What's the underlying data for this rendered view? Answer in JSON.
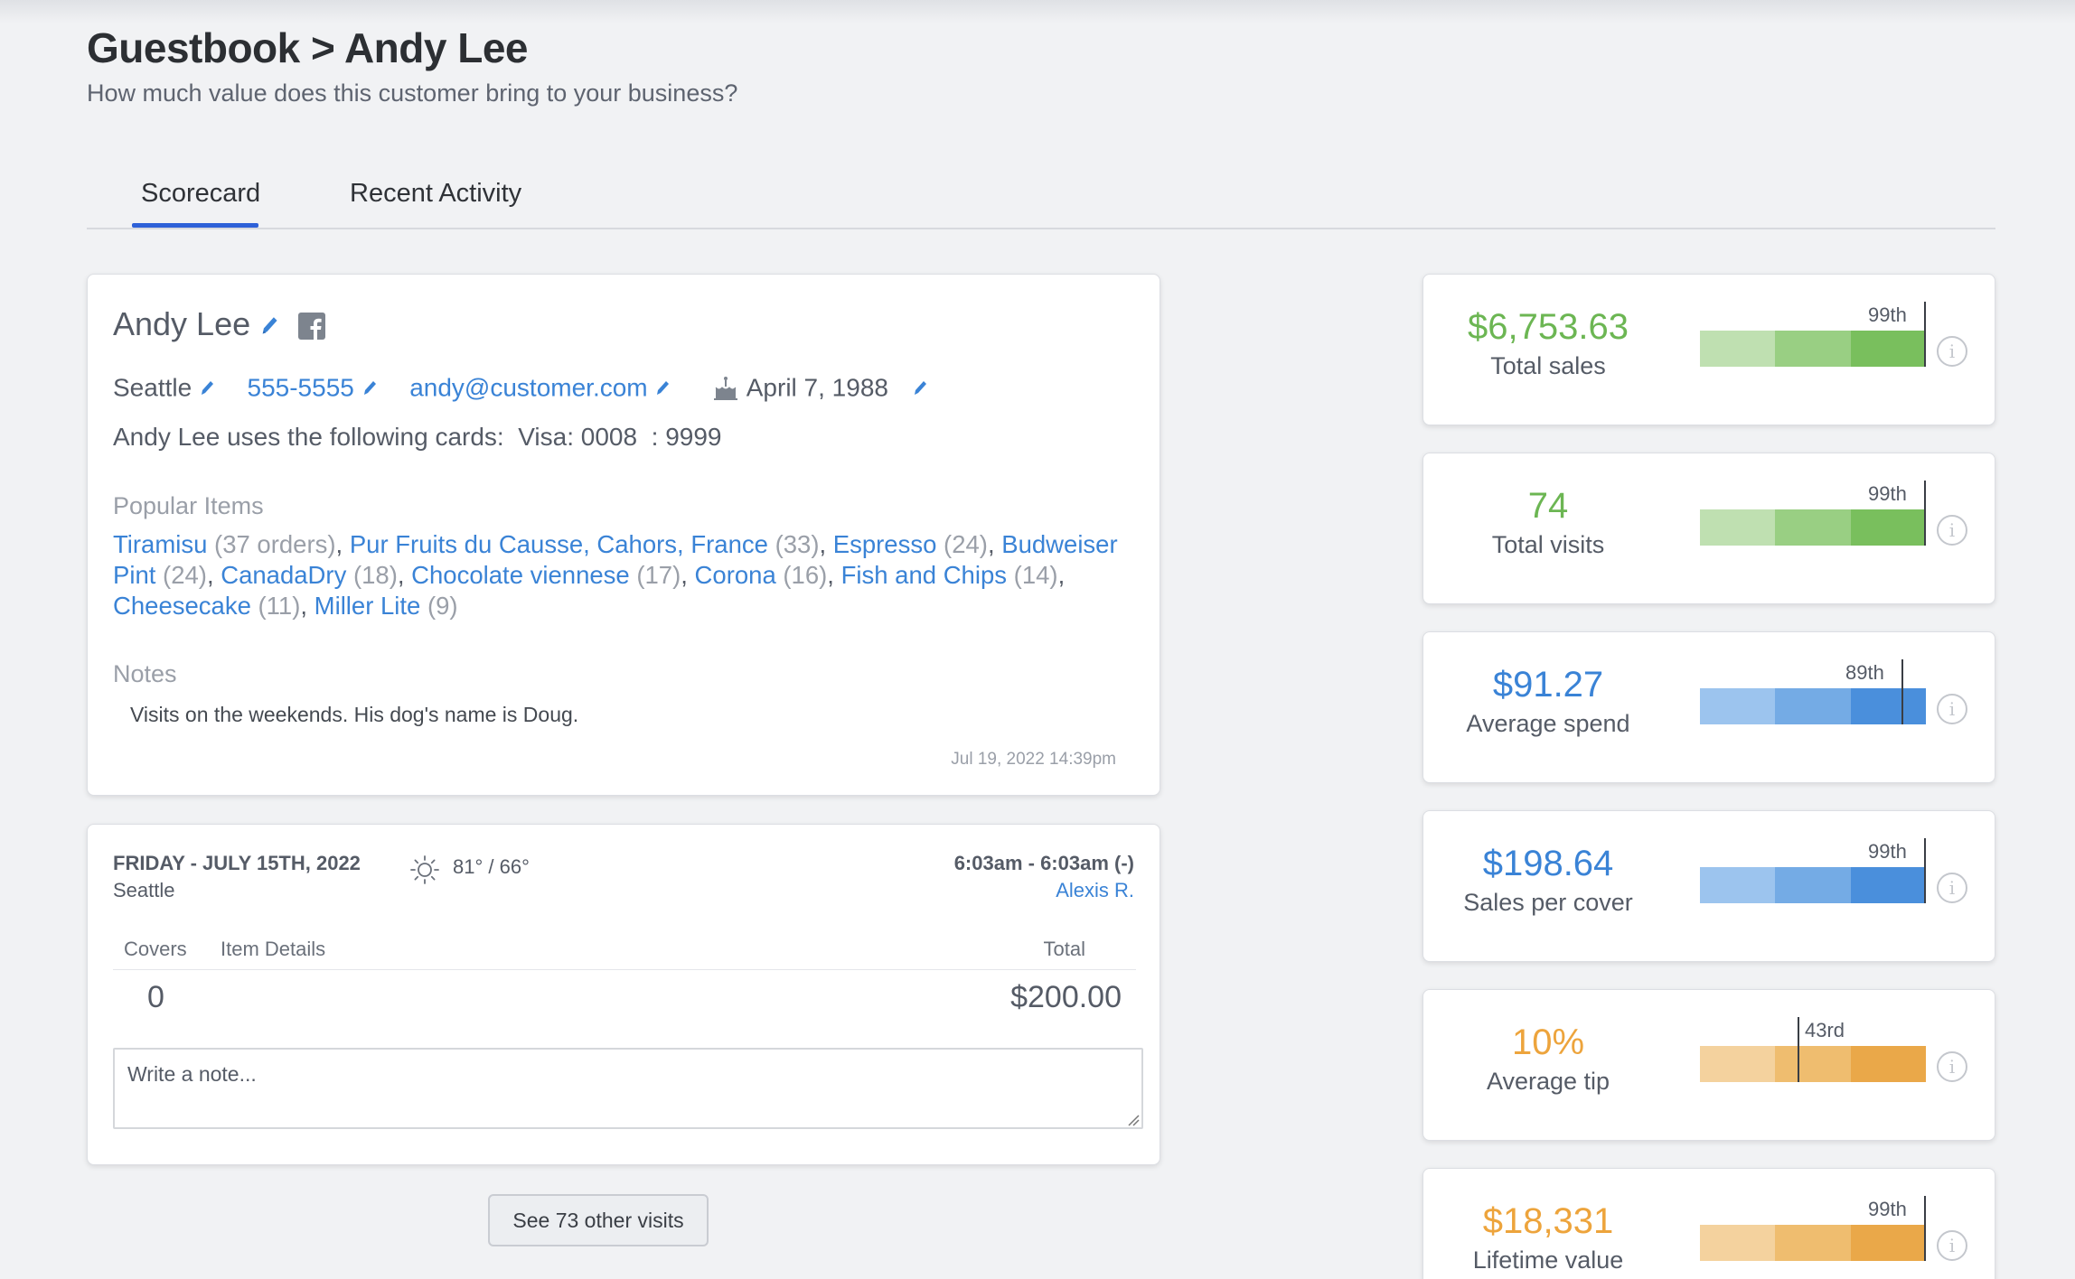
{
  "header": {
    "title": "Guestbook > Andy Lee",
    "subtitle": "How much value does this customer bring to your business?"
  },
  "tabs": [
    {
      "label": "Scorecard",
      "active": true
    },
    {
      "label": "Recent Activity",
      "active": false
    }
  ],
  "profile": {
    "name": "Andy Lee",
    "city": "Seattle",
    "phone": "555-5555",
    "email": "andy@customer.com",
    "birthday": "April 7, 1988",
    "cards_text": "Andy Lee uses the following cards:  Visa: 0008  : 9999",
    "popular_heading": "Popular Items",
    "popular_items": [
      {
        "name": "Tiramisu",
        "count": "(37 orders)"
      },
      {
        "name": "Pur Fruits du Causse, Cahors, France",
        "count": "(33)"
      },
      {
        "name": "Espresso",
        "count": "(24)"
      },
      {
        "name": "Budweiser Pint",
        "count": "(24)"
      },
      {
        "name": "CanadaDry",
        "count": "(18)"
      },
      {
        "name": "Chocolate viennese",
        "count": "(17)"
      },
      {
        "name": "Corona",
        "count": "(16)"
      },
      {
        "name": "Fish and Chips",
        "count": "(14)"
      },
      {
        "name": "Cheesecake",
        "count": "(11)"
      },
      {
        "name": "Miller Lite",
        "count": "(9)"
      }
    ],
    "notes_heading": "Notes",
    "note_text": "Visits on the weekends. His dog's name is Doug.",
    "note_timestamp": "Jul 19, 2022 14:39pm"
  },
  "visit": {
    "date": "FRIDAY - JULY 15TH, 2022",
    "city": "Seattle",
    "weather": "81° / 66°",
    "weather_icon": "sun-icon",
    "time": "6:03am - 6:03am (-)",
    "server": "Alexis R.",
    "col_covers": "Covers",
    "col_items": "Item Details",
    "col_total": "Total",
    "covers": "0",
    "total": "$200.00",
    "note_placeholder": "Write a note..."
  },
  "more_visits_label": "See 73 other visits",
  "stats": [
    {
      "value": "$6,753.63",
      "label": "Total sales",
      "percentile": "99th",
      "percentile_value": 99,
      "color": "#6cb653",
      "shades": [
        "#bfe0b1",
        "#99cf83",
        "#79bf5d"
      ]
    },
    {
      "value": "74",
      "label": "Total visits",
      "percentile": "99th",
      "percentile_value": 99,
      "color": "#6cb653",
      "shades": [
        "#bfe0b1",
        "#99cf83",
        "#79bf5d"
      ]
    },
    {
      "value": "$91.27",
      "label": "Average spend",
      "percentile": "89th",
      "percentile_value": 89,
      "color": "#3a83d6",
      "shades": [
        "#9cc4ee",
        "#74abe5",
        "#4a8fdc"
      ]
    },
    {
      "value": "$198.64",
      "label": "Sales per cover",
      "percentile": "99th",
      "percentile_value": 99,
      "color": "#3a83d6",
      "shades": [
        "#9cc4ee",
        "#74abe5",
        "#4a8fdc"
      ]
    },
    {
      "value": "10%",
      "label": "Average tip",
      "percentile": "43rd",
      "percentile_value": 43,
      "color": "#eda43c",
      "shades": [
        "#f4d29e",
        "#efbd6f",
        "#eaa849"
      ]
    },
    {
      "value": "$18,331",
      "label": "Lifetime value",
      "percentile": "99th",
      "percentile_value": 99,
      "color": "#eda43c",
      "shades": [
        "#f4d29e",
        "#efbd6f",
        "#eaa849"
      ]
    }
  ]
}
